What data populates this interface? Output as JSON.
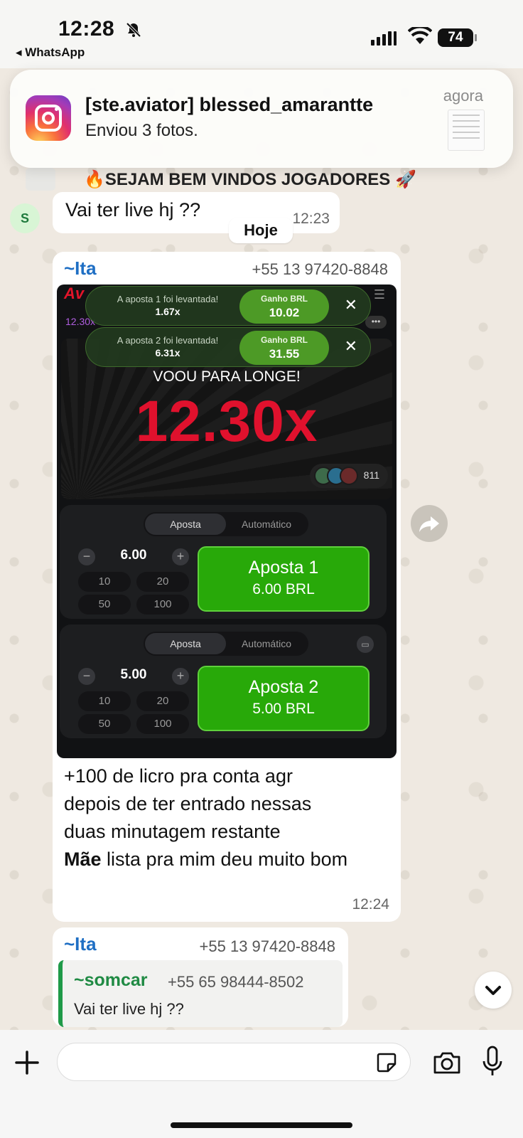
{
  "status_bar": {
    "time": "12:28",
    "back_app": "◂ WhatsApp",
    "battery": "74"
  },
  "notification": {
    "title": "[ste.aviator] blessed_amarantte",
    "body": "Enviou 3 fotos.",
    "time": "agora",
    "app_icon": "instagram-icon"
  },
  "pinned": {
    "text": "🔥SEJAM BEM VINDOS JOGADORES 🚀"
  },
  "chat": {
    "day_separator": "Hoje",
    "messages": [
      {
        "avatar_letter": "S",
        "text": "Vai ter live hj ??",
        "time": "12:23"
      },
      {
        "sender": "~Ita",
        "phone": "+55 13 97420-8848",
        "caption_lines": [
          "+100 de licro pra conta agr",
          "depois de ter entrado nessas",
          "duas minutagem restante"
        ],
        "caption_bold": "Mãe",
        "caption_rest": " lista pra mim deu muito bom",
        "time": "12:24"
      },
      {
        "sender": "~Ita",
        "phone": "+55 13 97420-8848",
        "quote": {
          "sender": "~somcar",
          "phone": "+55 65 98444-8502",
          "text": "Vai ter live hj ??"
        }
      }
    ]
  },
  "game_screenshot": {
    "history_first": "12.30x",
    "toasts": [
      {
        "text": "A aposta 1 foi levantada!",
        "mult": "1.67x",
        "win_label": "Ganho BRL",
        "win_value": "10.02"
      },
      {
        "text": "A aposta 2 foi levantada!",
        "mult": "6.31x",
        "win_label": "Ganho BRL",
        "win_value": "31.55"
      }
    ],
    "flew_text": "VOOU PARA LONGE!",
    "multiplier": "12.30x",
    "players_count": "811",
    "panels": [
      {
        "tab_active": "Aposta",
        "tab_other": "Automático",
        "amount": "6.00",
        "quick": [
          "10",
          "20",
          "50",
          "100"
        ],
        "button_title": "Aposta 1",
        "button_amount": "6.00 BRL"
      },
      {
        "tab_active": "Aposta",
        "tab_other": "Automático",
        "amount": "5.00",
        "quick": [
          "10",
          "20",
          "50",
          "100"
        ],
        "button_title": "Aposta 2",
        "button_amount": "5.00 BRL"
      }
    ]
  },
  "input": {
    "placeholder": ""
  },
  "colors": {
    "whatsapp_green": "#1f9a48",
    "bet_green": "#28a909",
    "multiplier_red": "#e0112d",
    "sender_blue": "#1f6fc4"
  }
}
